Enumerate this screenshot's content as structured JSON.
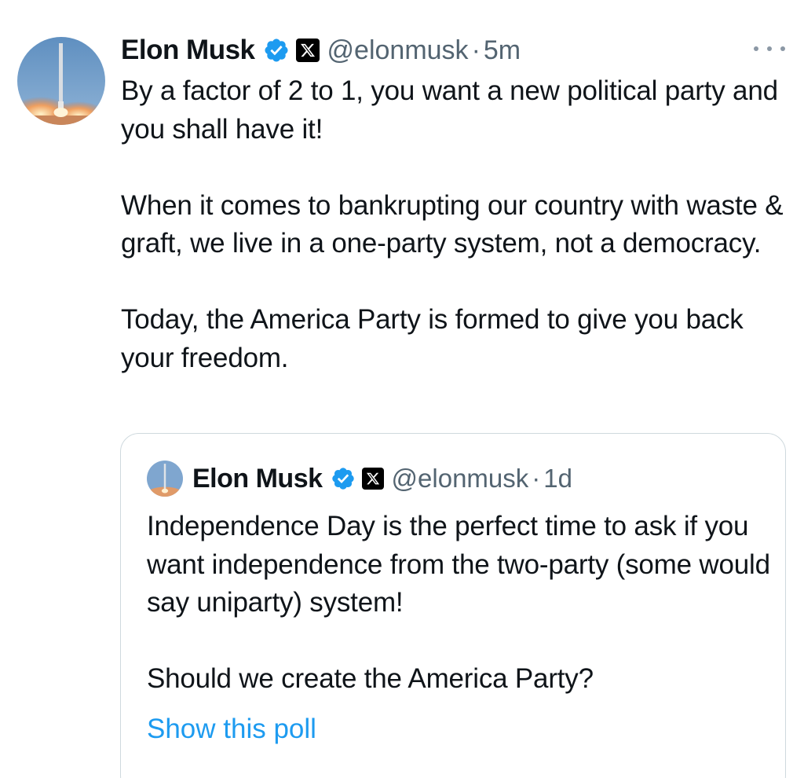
{
  "tweet": {
    "author_name": "Elon Musk",
    "handle": "@elonmusk",
    "separator": "·",
    "time": "5m",
    "paragraphs": [
      "By a factor of 2 to 1, you want a new political party and you shall have it!",
      "When it comes to bankrupting our country with waste & graft, we live in a one-party system, not a democracy.",
      "Today, the America Party is formed to give you back your freedom."
    ]
  },
  "quoted_tweet": {
    "author_name": "Elon Musk",
    "handle": "@elonmusk",
    "separator": "·",
    "time": "1d",
    "paragraphs": [
      "Independence Day is the perfect time to ask if you want independence from the two-party (some would say uniparty) system!",
      "Should we create the America Party?"
    ],
    "poll_link": "Show this poll"
  },
  "icons": {
    "avatar": "rocket-launch-avatar",
    "verified": "verified-badge-icon",
    "affiliation": "x-logo-icon",
    "more": "more-options-icon"
  },
  "colors": {
    "text": "#0f1419",
    "secondary": "#536471",
    "link": "#1d9bf0",
    "verified": "#1d9bf0",
    "border": "#cfd9de"
  }
}
